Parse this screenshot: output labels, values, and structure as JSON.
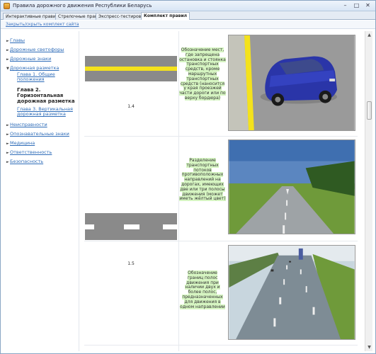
{
  "window": {
    "title": "Правила дорожного движения Республики Беларусь"
  },
  "title_buttons": {
    "minimize": "–",
    "maximize": "□",
    "close": "✕"
  },
  "tabs": [
    {
      "label": "Интерактивные правила"
    },
    {
      "label": "Стрелочные правила"
    },
    {
      "label": "Экспресс-тестирование"
    },
    {
      "label": "Комплект правил"
    }
  ],
  "toolbar": {
    "hide_link": "Закрыть/скрыть комплект сайта"
  },
  "sidebar": {
    "items": [
      {
        "label": "Главы"
      },
      {
        "label": "Дорожные светофоры"
      },
      {
        "label": "Дорожные знаки"
      },
      {
        "label": "Дорожная разметка"
      },
      {
        "label": "Неисправности"
      },
      {
        "label": "Опознавательные знаки"
      },
      {
        "label": "Медицина"
      },
      {
        "label": "Ответственность"
      },
      {
        "label": "Безопасность"
      }
    ],
    "subitems": [
      {
        "label": "Глава 1. Общие положения"
      },
      {
        "label": "Глава 2. Горизонтальная дорожная разметка"
      },
      {
        "label": "Глава 3. Вертикальная дорожная разметка"
      }
    ]
  },
  "markings": [
    {
      "sign_label": "1.4",
      "description": "Обозначение мест, где запрещена остановка и стоянка транспортных средств, кроме маршрутных транспортных средств (наносится у края проезжей части дороги или по верху бордюра)"
    },
    {
      "sign_label": "",
      "description": "Разделение транспортных потоков противоположных направлений на дорогах, имеющих две или три полосы движения (может иметь жёлтый цвет)"
    },
    {
      "sign_label": "1.5",
      "description": "Обозначение границ полос движения при наличии двух и более полос, предназначенных для движения в одном направлении"
    }
  ],
  "colors": {
    "link": "#2e6cb8",
    "highlight": "#d6f5c2",
    "marking_yellow": "#f4e21c",
    "asphalt": "#8a8a8a"
  }
}
